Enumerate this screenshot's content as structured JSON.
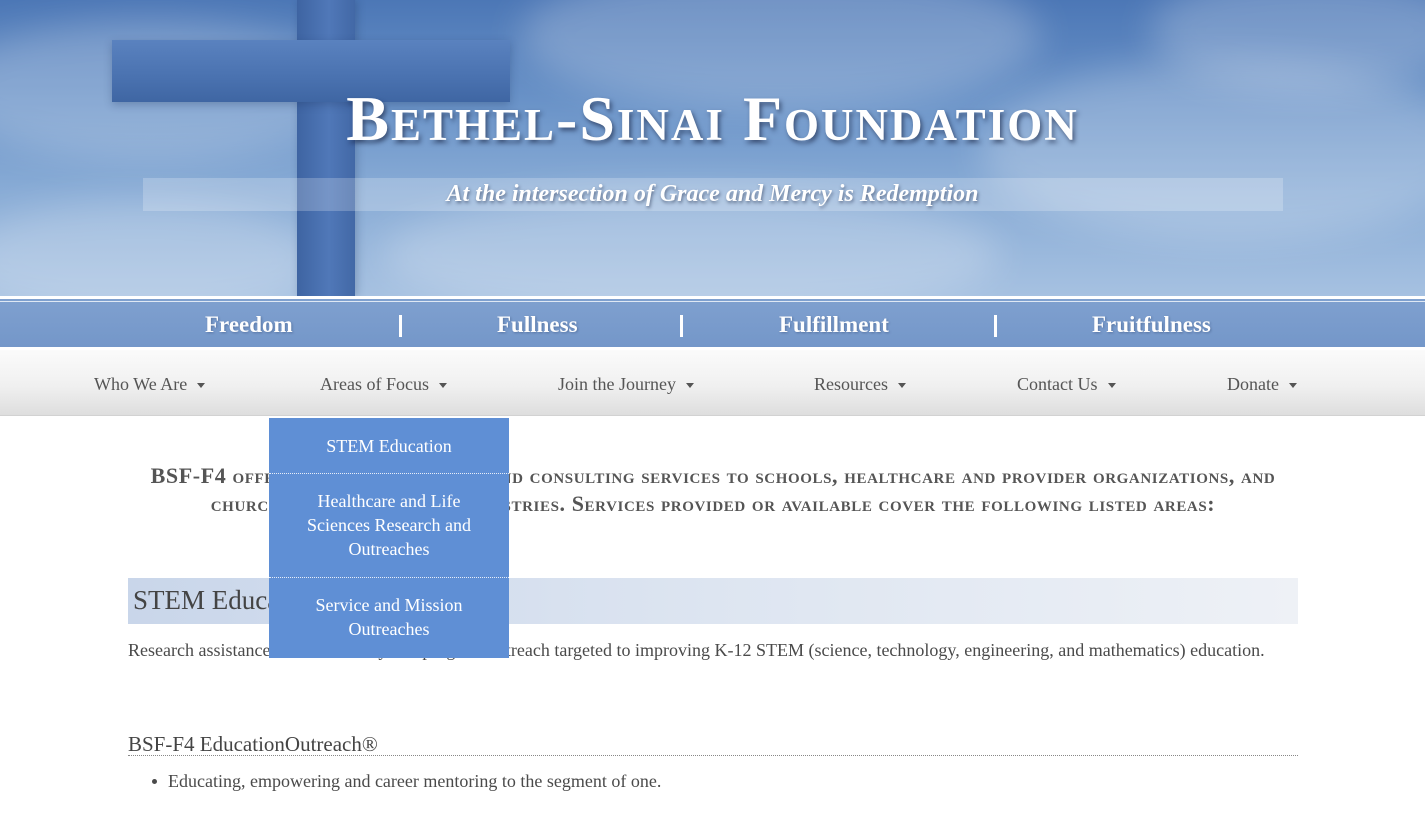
{
  "hero": {
    "title": "Bethel-Sinai Foundation",
    "tagline": "At the intersection of Grace and Mercy is Redemption"
  },
  "fbar": {
    "items": [
      "Freedom",
      "Fullness",
      "Fulfillment",
      "Fruitfulness"
    ],
    "separator": "|"
  },
  "nav": {
    "items": [
      {
        "label": "Who We Are"
      },
      {
        "label": "Areas of Focus"
      },
      {
        "label": "Join the Journey"
      },
      {
        "label": "Resources"
      },
      {
        "label": "Contact Us"
      },
      {
        "label": "Donate"
      }
    ]
  },
  "dropdown": {
    "items": [
      {
        "label": "STEM Education"
      },
      {
        "label": "Healthcare and Life Sciences Research and Outreaches"
      },
      {
        "label": "Service and Mission Outreaches"
      }
    ]
  },
  "content": {
    "intro": "BSF-F4 offers research, training and consulting services to schools, healthcare and provider organizations, and churches and faith-based ministries. Services provided or available cover the following listed areas:",
    "section_title": "STEM Education",
    "section_text": "Research assistance and community and program outreach targeted to improving K-12 STEM (science, technology, engineering, and mathematics) education.",
    "subsection_title": "BSF-F4 EducationOutreach®",
    "bullets": [
      "Educating, empowering and career mentoring to the segment of one."
    ]
  },
  "colors": {
    "sky": "#6a93c8",
    "fbar": "#7a9ccc",
    "dropdown": "#5f8fd5",
    "section_band": "#d4dded",
    "text": "#4a4a4a"
  }
}
